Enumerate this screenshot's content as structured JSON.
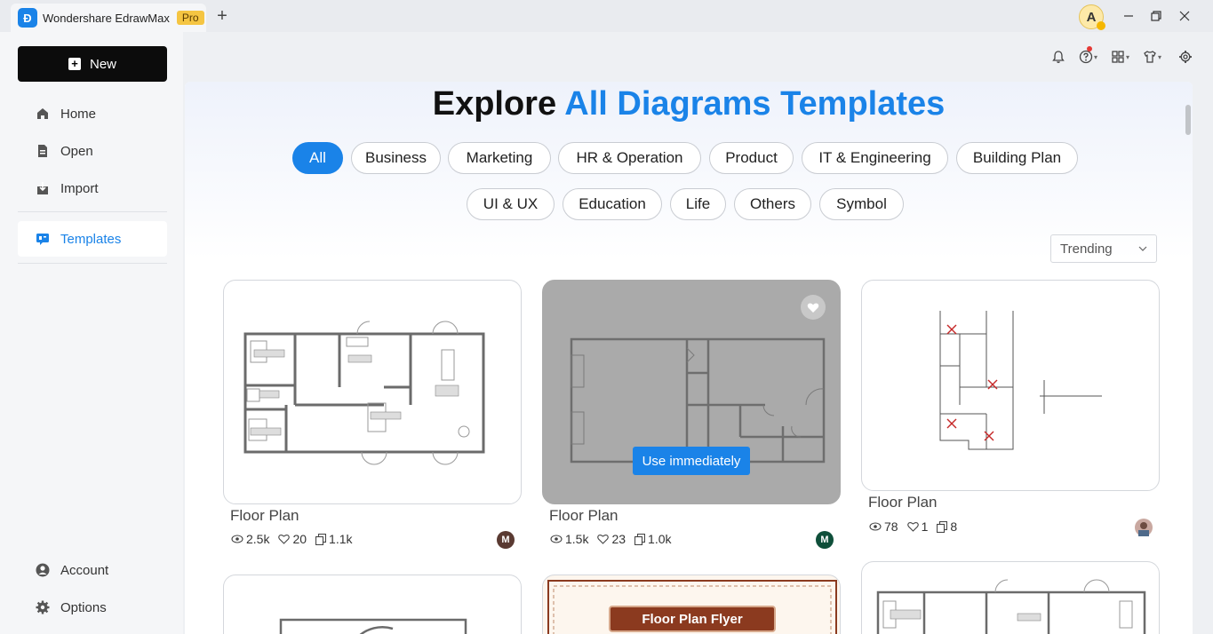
{
  "titlebar": {
    "app_title": "Wondershare EdrawMax",
    "badge": "Pro",
    "new_tab": "+",
    "avatar_letter": "A"
  },
  "sidebar": {
    "new_label": "New",
    "items": [
      {
        "label": "Home",
        "icon": "home-icon"
      },
      {
        "label": "Open",
        "icon": "file-icon"
      },
      {
        "label": "Import",
        "icon": "import-icon"
      },
      {
        "label": "Templates",
        "icon": "templates-icon",
        "active": true
      }
    ],
    "bottom_items": [
      {
        "label": "Account",
        "icon": "account-icon"
      },
      {
        "label": "Options",
        "icon": "gear-icon"
      }
    ]
  },
  "toolbar": {
    "icons": [
      "bell-icon",
      "help-icon",
      "apps-icon",
      "shirt-icon",
      "settings-icon"
    ]
  },
  "main": {
    "heading_plain": "Explore",
    "heading_highlight": "All Diagrams Templates",
    "categories_row1": [
      "All",
      "Business",
      "Marketing",
      "HR & Operation",
      "Product",
      "IT & Engineering",
      "Building Plan"
    ],
    "categories_row2": [
      "UI & UX",
      "Education",
      "Life",
      "Others",
      "Symbol"
    ],
    "active_category": "All",
    "sort": "Trending",
    "cards": [
      {
        "title": "Floor Plan",
        "views": "2.5k",
        "likes": "20",
        "copies": "1.1k",
        "author": "M"
      },
      {
        "title": "Floor Plan",
        "views": "1.5k",
        "likes": "23",
        "copies": "1.0k",
        "author": "M",
        "hover_button": "Use immediately"
      },
      {
        "title": "Floor Plan",
        "views": "78",
        "likes": "1",
        "copies": "8",
        "author": ""
      }
    ],
    "flyer_label": "Floor Plan Flyer"
  },
  "colors": {
    "accent": "#1a83e8",
    "sidebar_bg": "#f5f6f8",
    "new_button": "#0c0c0c",
    "pro_badge": "#f5c542"
  }
}
